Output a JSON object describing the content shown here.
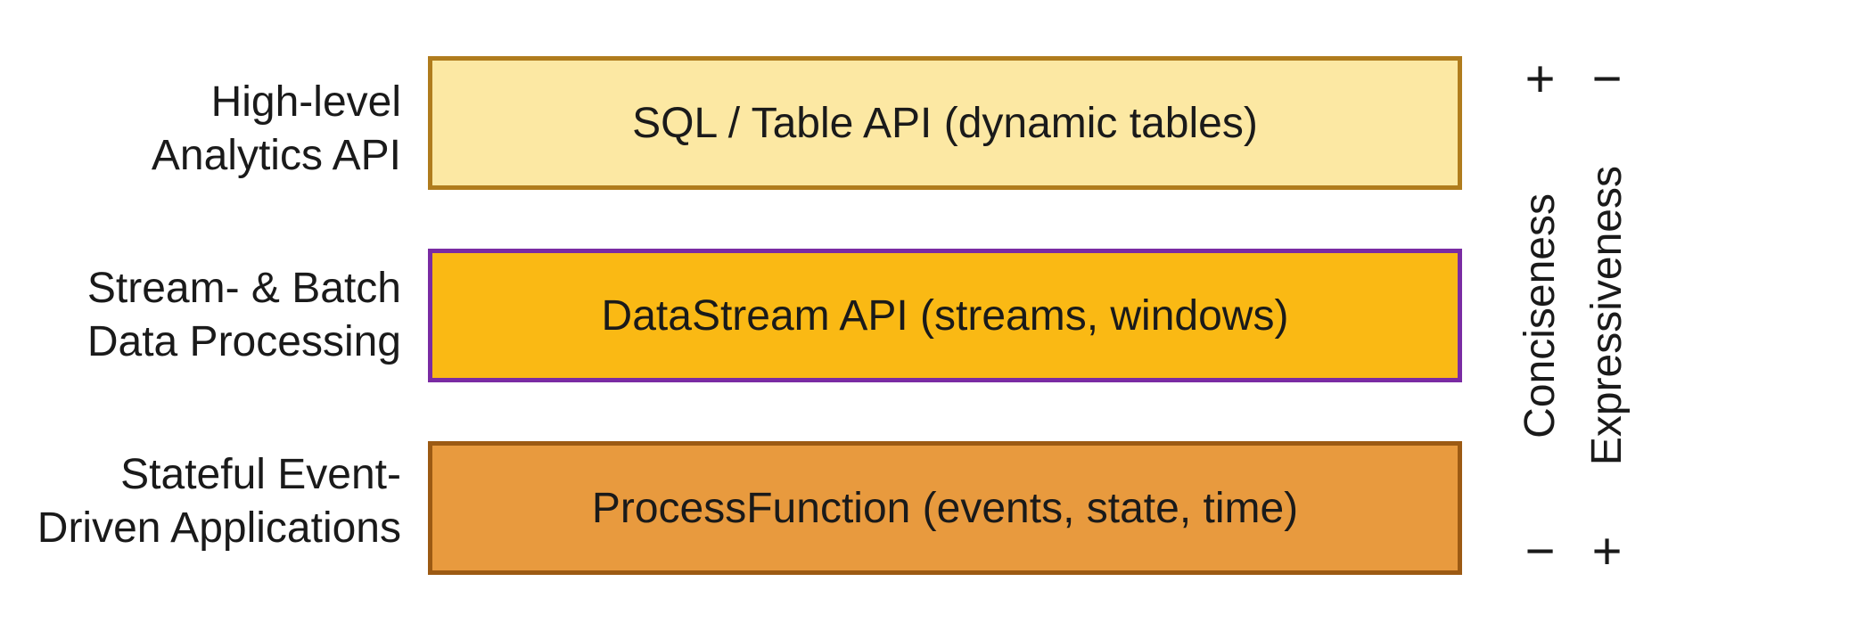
{
  "layers": [
    {
      "left_label": "High-level\nAnalytics API",
      "box_label": "SQL / Table API (dynamic tables)"
    },
    {
      "left_label": "Stream- & Batch\nData Processing",
      "box_label": "DataStream API (streams, windows)"
    },
    {
      "left_label": "Stateful Event-\nDriven Applications",
      "box_label": "ProcessFunction (events, state, time)"
    }
  ],
  "scales": {
    "conciseness": {
      "label": "Conciseness",
      "top": "+",
      "bottom": "−"
    },
    "expressiveness": {
      "label": "Expressiveness",
      "top": "−",
      "bottom": "+"
    }
  }
}
